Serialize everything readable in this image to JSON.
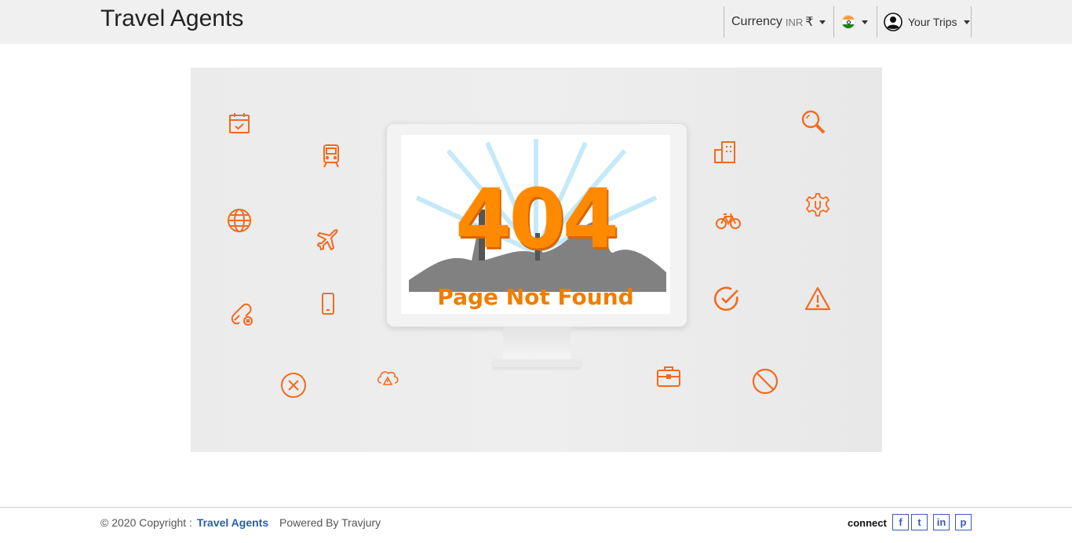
{
  "header": {
    "brand": "Travel Agents",
    "currency_label": "Currency",
    "currency_code": "INR",
    "currency_symbol": "₹",
    "trips_label": "Your Trips"
  },
  "error": {
    "code": "404",
    "title": "Page Not Found"
  },
  "icons": [
    "calendar-icon",
    "train-icon",
    "globe-icon",
    "airplane-icon",
    "broken-link-icon",
    "mobile-icon",
    "close-circle-icon",
    "cloud-warning-icon",
    "building-icon",
    "bicycle-icon",
    "check-circle-icon",
    "briefcase-icon",
    "search-icon",
    "settings-icon",
    "warning-icon",
    "blocked-icon"
  ],
  "footer": {
    "copyright": "© 2020 Copyright :",
    "brand_link": "Travel Agents",
    "powered": "Powered By Travjury",
    "connect": "connect",
    "social": {
      "facebook": "f",
      "twitter": "t",
      "linkedin": "in",
      "pinterest": "p"
    }
  },
  "colors": {
    "accent": "#f26b1d",
    "error_orange": "#ff8a00",
    "link_blue": "#2a5db0",
    "header_bg": "#f0f0f0"
  }
}
